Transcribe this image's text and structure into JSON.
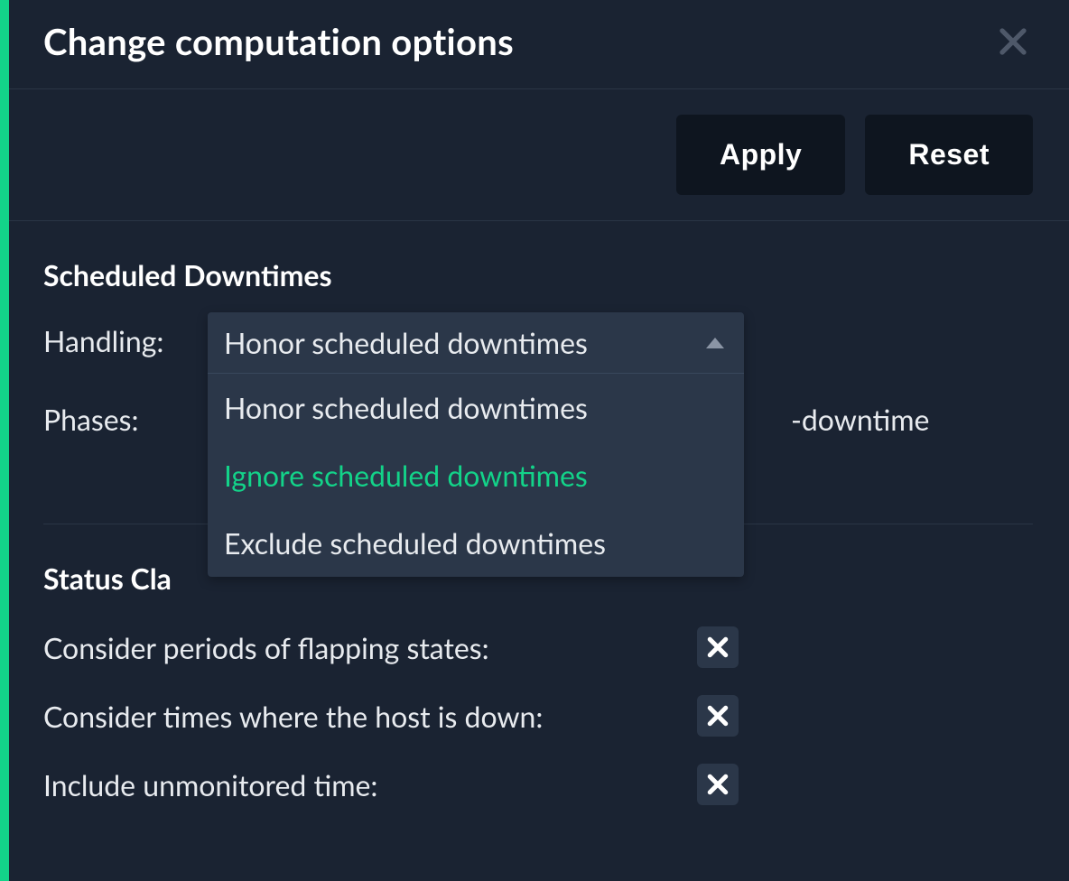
{
  "dialog": {
    "title": "Change computation options",
    "actions": {
      "apply": "Apply",
      "reset": "Reset"
    }
  },
  "scheduled_downtimes": {
    "section_title": "Scheduled Downtimes",
    "handling_label": "Handling:",
    "phases_label": "Phases:",
    "phases_value_suffix": "-downtime",
    "dropdown": {
      "selected": "Honor scheduled downtimes",
      "options": [
        {
          "label": "Honor scheduled downtimes",
          "highlighted": false
        },
        {
          "label": "Ignore scheduled downtimes",
          "highlighted": true
        },
        {
          "label": "Exclude scheduled downtimes",
          "highlighted": false
        }
      ]
    }
  },
  "status_classification": {
    "section_title_visible": "Status Cla",
    "rows": [
      {
        "label": "Consider periods of flapping states:",
        "checked": false
      },
      {
        "label": "Consider times where the host is down:",
        "checked": false
      },
      {
        "label": "Include unmonitored time:",
        "checked": false
      }
    ]
  }
}
